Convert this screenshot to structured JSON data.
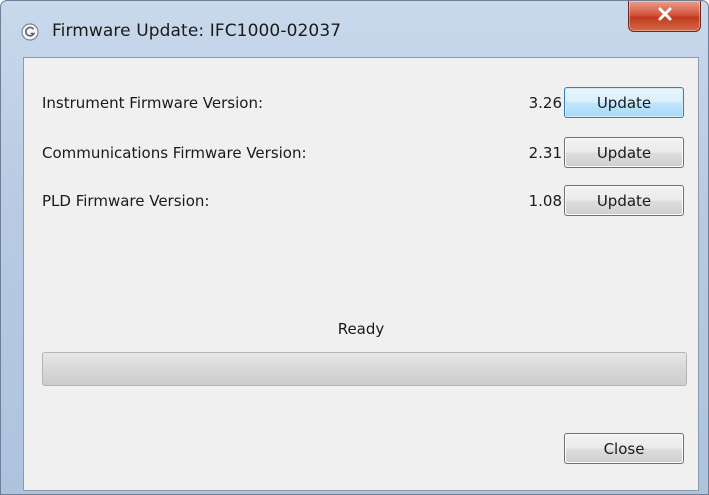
{
  "window": {
    "title": "Firmware Update: IFC1000-02037",
    "close_glyph": "✕"
  },
  "firmware": {
    "rows": [
      {
        "label": "Instrument Firmware Version:",
        "version": "3.26",
        "button": "Update"
      },
      {
        "label": "Communications Firmware Version:",
        "version": "2.31",
        "button": "Update"
      },
      {
        "label": "PLD Firmware Version:",
        "version": "1.08",
        "button": "Update"
      }
    ]
  },
  "status": {
    "text": "Ready",
    "progress": 0
  },
  "footer": {
    "close_label": "Close"
  },
  "icons": {
    "app": "app-logo-icon",
    "close": "close-icon"
  },
  "colors": {
    "window_frame": "#b8cbe3",
    "close_button": "#c03b20",
    "focused_button": "#3c7fb1"
  }
}
